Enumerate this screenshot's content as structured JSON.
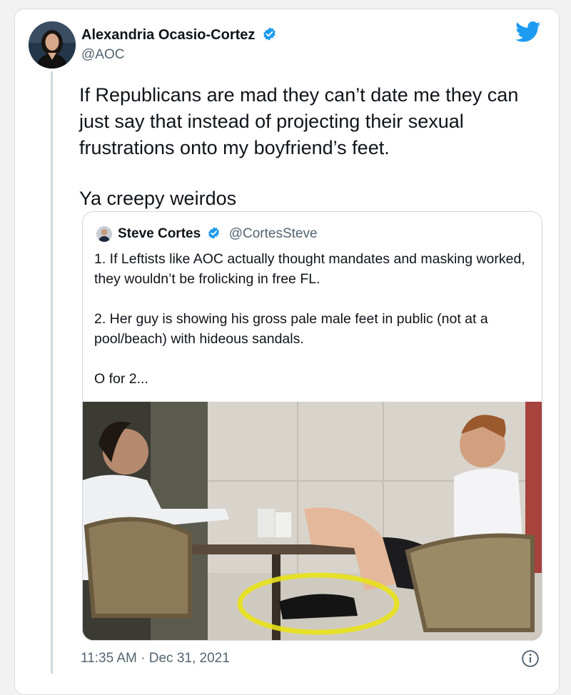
{
  "tweet": {
    "author": {
      "name": "Alexandria Ocasio-Cortez",
      "handle": "@AOC",
      "verified": true
    },
    "text_lines": [
      "If Republicans are mad they can’t date me they can\njust say that instead of projecting their sexual\nfrustrations onto my boyfriend’s feet.",
      "Ya creepy weirdos"
    ],
    "timestamp": "11:35 AM · Dec 31, 2021"
  },
  "quoted_tweet": {
    "author": {
      "name": "Steve Cortes",
      "handle": "@CortesSteve",
      "verified": true
    },
    "paragraphs": [
      "1. If Leftists like AOC actually thought mandates and masking worked, they wouldn’t be frolicking in free FL.",
      "2. Her guy is showing his gross pale male feet in public (not at a pool/beach) with hideous sandals.",
      "O for 2..."
    ],
    "photo": {
      "alt": "Photo of two people seated at an outdoor cafe table, one foot circled in yellow"
    }
  },
  "icons": [
    "twitter-bird-icon",
    "verified-badge-icon",
    "info-icon"
  ],
  "colors": {
    "accent": "#1d9bf0",
    "text": "#0f1419",
    "secondary": "#536471",
    "highlight": "#e8e21b"
  }
}
